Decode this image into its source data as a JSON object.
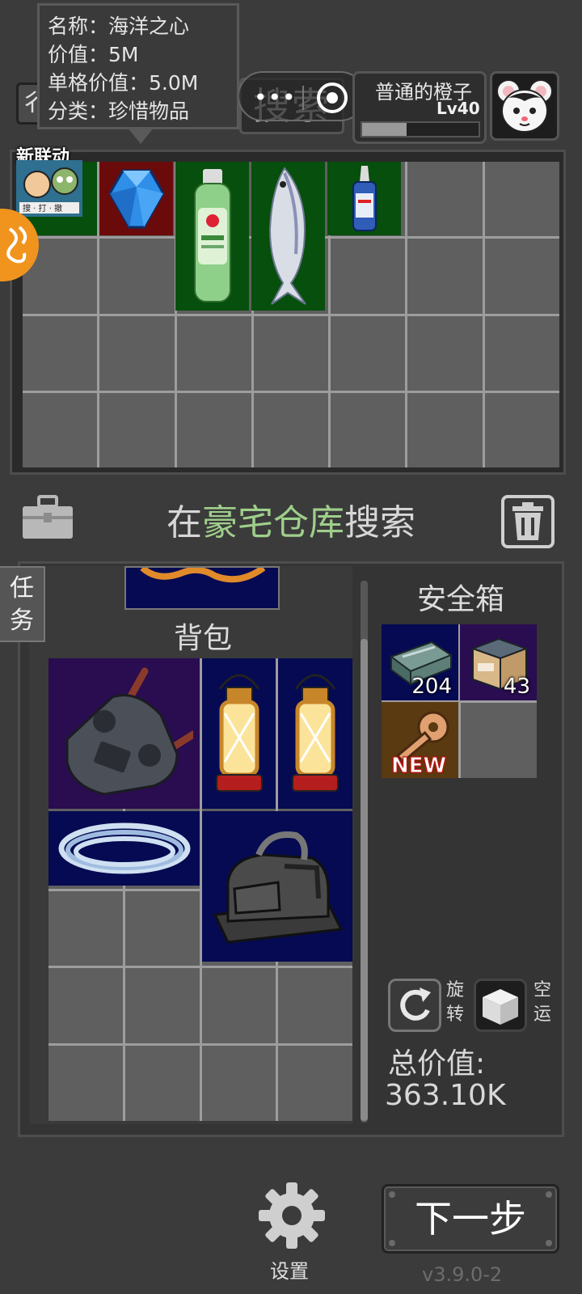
{
  "header": {
    "back_glyph": "彳",
    "search_label": "搜索",
    "player_name": "普通的橙子",
    "player_level": "Lv40",
    "xp_fraction": 0.38,
    "avatar": "white-mouse-avatar"
  },
  "tooltip": {
    "name_line": "名称：海洋之心",
    "value_line": "价值：5M",
    "unit_value_line": "单格价值：5.0M",
    "category_line": "分类：珍惜物品"
  },
  "event": {
    "label": "新联动"
  },
  "location": {
    "prefix": "在",
    "place": "豪宅仓库",
    "suffix": "搜索"
  },
  "task_tab": {
    "line1": "任",
    "line2": "务"
  },
  "backpack": {
    "title": "背包"
  },
  "safe_box": {
    "title": "安全箱",
    "items": [
      {
        "name": "ammo-box",
        "qty": "204"
      },
      {
        "name": "supply-crate",
        "qty": "43"
      },
      {
        "name": "key",
        "tag": "NEW"
      }
    ]
  },
  "actions": {
    "rotate_label": "旋转",
    "airdrop_label": "空运",
    "total_label": "总价值:",
    "total_value": "363.10K"
  },
  "footer": {
    "settings_label": "设置",
    "next_label": "下一步",
    "version": "v3.9.0-2"
  },
  "colors": {
    "rare_red": "#6b0a0a",
    "common_green": "#064f0d",
    "epic_purple": "#2a0c50",
    "blue": "#050a52",
    "gold_brown": "#5a3a10",
    "location_highlight": "#9fcf8b"
  }
}
